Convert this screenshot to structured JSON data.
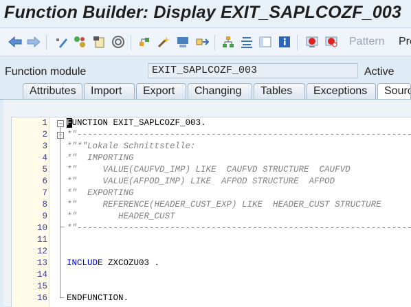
{
  "window": {
    "title": "Function Builder: Display EXIT_SAPLCOZF_003"
  },
  "toolbar": {
    "icons": [
      "back-arrow-icon",
      "forward-arrow-icon",
      "display-change-icon",
      "active-inactive-icon",
      "other-object-icon",
      "check-icon",
      "activate-icon",
      "where-used-icon",
      "test-icon",
      "navigation-icon",
      "hierarchy-icon",
      "pretty-printer-icon",
      "display-object-list-icon",
      "info-icon",
      "breakpoint-icon",
      "session-breakpoint-icon"
    ],
    "pattern_label": "Pattern",
    "pretty_label": "Pre"
  },
  "function_module": {
    "label": "Function module",
    "value": "EXIT_SAPLCOZF_003",
    "status": "Active"
  },
  "tabs": [
    {
      "label": "Attributes",
      "active": false
    },
    {
      "label": "Import",
      "active": false
    },
    {
      "label": "Export",
      "active": false
    },
    {
      "label": "Changing",
      "active": false
    },
    {
      "label": "Tables",
      "active": false
    },
    {
      "label": "Exceptions",
      "active": false
    },
    {
      "label": "Source code",
      "active": true
    }
  ],
  "source": {
    "lines": [
      {
        "num": "1",
        "text": "FUNCTION EXIT_SAPLCOZF_003."
      },
      {
        "num": "2",
        "text": "*\"----------------------------------------------------------------------"
      },
      {
        "num": "3",
        "text": "*\"*\"Lokale Schnittstelle:"
      },
      {
        "num": "4",
        "text": "*\"  IMPORTING"
      },
      {
        "num": "5",
        "text": "*\"     VALUE(CAUFVD_IMP) LIKE  CAUFVD STRUCTURE  CAUFVD"
      },
      {
        "num": "6",
        "text": "*\"     VALUE(AFPOD_IMP) LIKE  AFPOD STRUCTURE  AFPOD"
      },
      {
        "num": "7",
        "text": "*\"  EXPORTING"
      },
      {
        "num": "8",
        "text": "*\"     REFERENCE(HEADER_CUST_EXP) LIKE  HEADER_CUST STRUCTURE"
      },
      {
        "num": "9",
        "text": "*\"        HEADER_CUST"
      },
      {
        "num": "10",
        "text": "*\"----------------------------------------------------------------------"
      },
      {
        "num": "11",
        "text": ""
      },
      {
        "num": "12",
        "text": ""
      },
      {
        "num": "13",
        "text": "INCLUDE ZXCOZU03 ."
      },
      {
        "num": "14",
        "text": ""
      },
      {
        "num": "15",
        "text": ""
      },
      {
        "num": "16",
        "text": "ENDFUNCTION."
      }
    ]
  }
}
